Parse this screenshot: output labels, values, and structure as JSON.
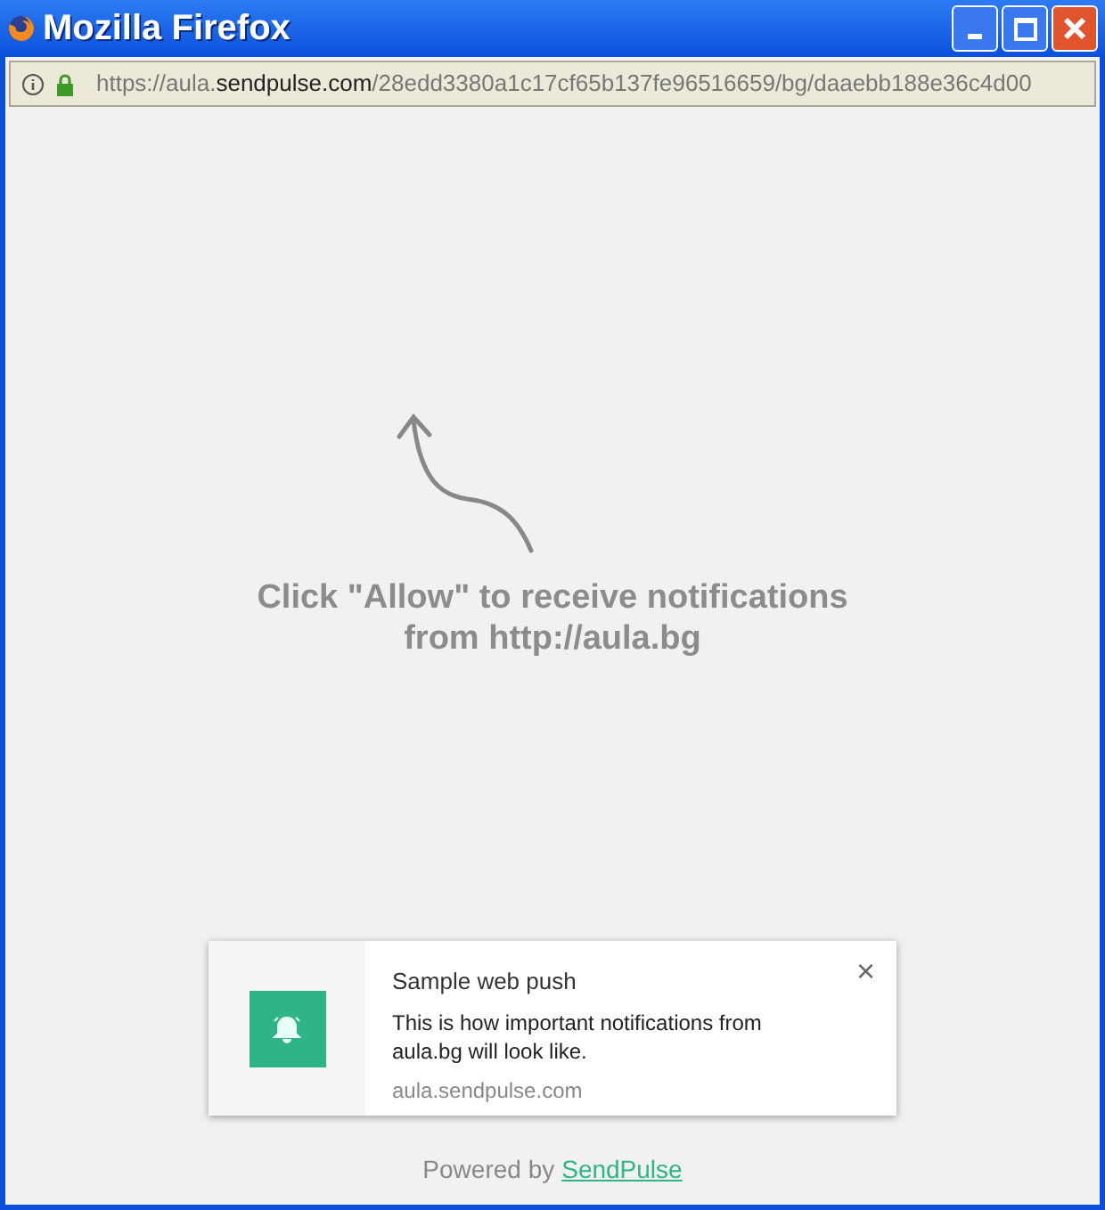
{
  "window": {
    "title": "Mozilla Firefox"
  },
  "address_bar": {
    "url_start": "https://aula.",
    "url_domain": "sendpulse.com",
    "url_rest": "/28edd3380a1c17cf65b137fe96516659/bg/daaebb188e36c4d00"
  },
  "prompt": {
    "lines": [
      "Click \"Allow\" to receive notifications",
      "from http://aula.bg"
    ]
  },
  "notification": {
    "title": "Sample web push",
    "body": "This is how important notifications from aula.bg will look like.",
    "source": "aula.sendpulse.com",
    "close": "×"
  },
  "footer": {
    "text": "Powered by",
    "link": "SendPulse"
  }
}
